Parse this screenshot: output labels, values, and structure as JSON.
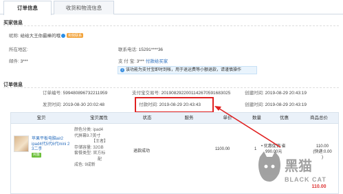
{
  "tabs": [
    {
      "label": "订单信息"
    },
    {
      "label": "收货和物流信息"
    }
  ],
  "buyer": {
    "section_title": "买家信息",
    "nickname_label": "昵称:",
    "nickname_value": "给给大王你最棒的哦",
    "nickname_badge": "和我联系",
    "region_label": "所在地区:",
    "region_value": "",
    "email_label": "邮件:",
    "email_value": "3***",
    "phone_label": "联系电话:",
    "phone_value": "15291****36",
    "alipay_label": "支 付 宝:",
    "alipay_value": "3***",
    "alipay_link": "付款给买家",
    "notice": "该功能为支付宝即时到帐，用于退运费等小额退款，请谨慎操作"
  },
  "order": {
    "section_title": "订单信息",
    "order_no_label": "订单编号:",
    "order_no_value": "599480896732211959",
    "alipay_trade_label": "支付宝交易号:",
    "alipay_trade_value": "20190829220011426705916830​25",
    "created_label": "创建时间:",
    "created_value": "2019-08-29 20:43:19",
    "shipped_label": "发货时间:",
    "shipped_value": "2019-08-30 20:02:48",
    "paid_label": "付款时间:",
    "paid_value": "2019-08-29 20:43:43"
  },
  "table": {
    "headers": [
      "宝贝",
      "宝贝属性",
      "状态",
      "服务",
      "单价",
      "数量",
      "优惠",
      "商品总价"
    ],
    "row": {
      "title": "苹果平板电脑air2 ipad4代5代6代mini 2 3二手",
      "tag": "闲鱼",
      "attrs": [
        "颜色分类: ipad4",
        "代屏幕9.7英寸",
        "【王者】",
        "存储容量: 32GB",
        "套餐类型: 官方标",
        "配",
        "成色: 9成新"
      ],
      "status": "退款成功",
      "price": "1100.00",
      "qty": "1",
      "discount_label": "优惠促销:省",
      "discount_value": "990.00元",
      "total": "110.00",
      "total_note": "(快递:0.00",
      "total_note2": ")",
      "total_bottom": "110.00"
    }
  },
  "watermark": {
    "cn": "黑猫",
    "en": "BLACK CAT"
  },
  "colors": {
    "link": "#2a6ebd",
    "highlight": "#e02020",
    "header_bg": "#eaf1f9"
  }
}
